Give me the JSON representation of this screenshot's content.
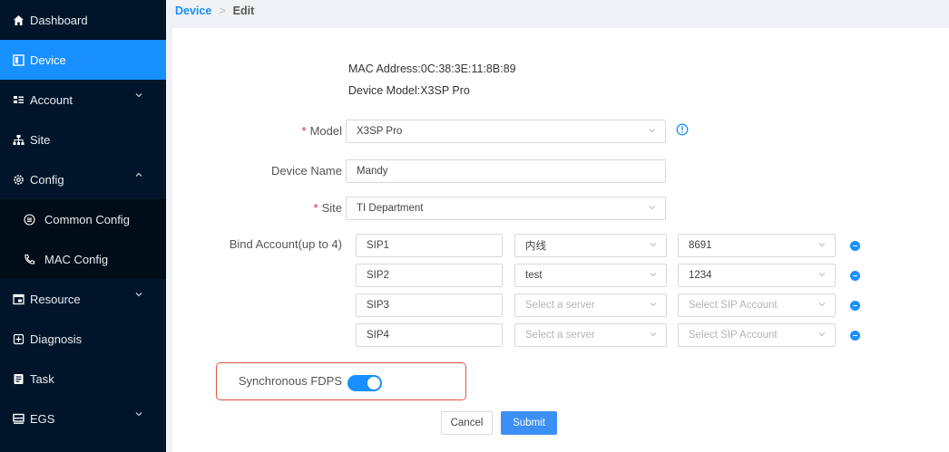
{
  "sidebar": {
    "items": [
      {
        "label": "Dashboard",
        "icon": "home-icon"
      },
      {
        "label": "Device",
        "icon": "device-icon"
      },
      {
        "label": "Account",
        "icon": "account-icon",
        "arrow": "down"
      },
      {
        "label": "Site",
        "icon": "site-icon"
      },
      {
        "label": "Config",
        "icon": "config-icon",
        "arrow": "up"
      },
      {
        "label": "Common Config",
        "icon": "common-config-icon"
      },
      {
        "label": "MAC Config",
        "icon": "phone-icon"
      },
      {
        "label": "Resource",
        "icon": "resource-icon",
        "arrow": "down"
      },
      {
        "label": "Diagnosis",
        "icon": "diagnosis-icon"
      },
      {
        "label": "Task",
        "icon": "task-icon"
      },
      {
        "label": "EGS",
        "icon": "egs-icon",
        "arrow": "down"
      }
    ],
    "active_item": "Device",
    "colors": {
      "bg": "#001529",
      "active": "#1890ff"
    }
  },
  "breadcrumb": {
    "parent": "Device",
    "separator": ">",
    "current": "Edit"
  },
  "device_info": {
    "mac_address": "MAC Address:0C:38:3E:11:8B:89",
    "device_model": "Device Model:X3SP Pro"
  },
  "form": {
    "model": {
      "label": "Model",
      "required": "*",
      "value": "X3SP Pro"
    },
    "device_name": {
      "label": "Device Name",
      "value": "Mandy"
    },
    "site": {
      "label": "Site",
      "required": "*",
      "value": "TI Department"
    },
    "bind_account": {
      "label": "Bind Account(up to 4)",
      "rows": [
        {
          "account": "SIP1",
          "server": "内线",
          "sip_account": "8691"
        },
        {
          "account": "SIP2",
          "server": "test",
          "sip_account": "1234"
        },
        {
          "account": "SIP3",
          "server": "Select a server",
          "sip_account": "Select SIP Account"
        },
        {
          "account": "SIP4",
          "server": "Select a server",
          "sip_account": "Select SIP Account"
        }
      ]
    },
    "synchronous_fdps": {
      "label": "Synchronous FDPS",
      "enabled": true
    }
  },
  "actions": {
    "cancel": "Cancel",
    "submit": "Submit"
  },
  "accent_color": "#1890ff",
  "highlight_color": "#e0533f"
}
